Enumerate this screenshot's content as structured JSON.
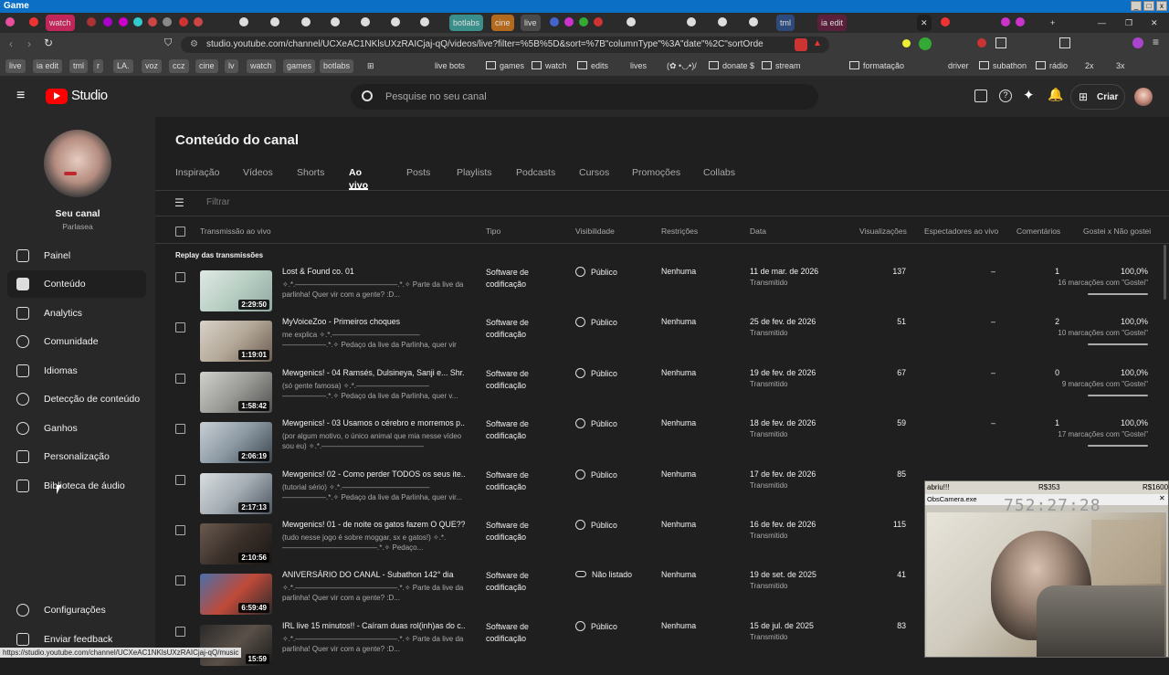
{
  "window": {
    "title": "Game"
  },
  "browser_tabs": [
    "watch",
    "botlabs",
    "cine",
    "live",
    "tml",
    "ia edit"
  ],
  "address_bar": {
    "url": "studio.youtube.com/channel/UCXeAC1NKlsUXzRAICjaj-qQ/videos/live?filter=%5B%5D&sort=%7B\"columnType\"%3A\"date\"%2C\"sortOrder\"%3A\"D..."
  },
  "bookmarks": {
    "chips": [
      "live",
      "ia edit",
      "tml",
      "r",
      "LA.",
      "voz",
      "ccz",
      "cine",
      "lv",
      "watch",
      "games",
      "botlabs"
    ],
    "items": [
      "live bots",
      "games",
      "watch",
      "edits",
      "lives",
      "(✿ •◡•)/",
      "donate $",
      "stream",
      "formatação",
      "driver",
      "subathon",
      "rádio",
      "2x",
      "3x"
    ]
  },
  "header": {
    "logo_text": "Studio",
    "search_placeholder": "Pesquise no seu canal",
    "create_label": "Criar"
  },
  "channel": {
    "name": "Seu canal",
    "handle": "Parlasea"
  },
  "sidebar": {
    "items": [
      {
        "label": "Painel",
        "icon": "dashboard-icon"
      },
      {
        "label": "Conteúdo",
        "icon": "content-icon",
        "active": true
      },
      {
        "label": "Analytics",
        "icon": "analytics-icon"
      },
      {
        "label": "Comunidade",
        "icon": "community-icon"
      },
      {
        "label": "Idiomas",
        "icon": "subtitles-icon"
      },
      {
        "label": "Detecção de conteúdo",
        "icon": "copyright-icon"
      },
      {
        "label": "Ganhos",
        "icon": "earn-icon"
      },
      {
        "label": "Personalização",
        "icon": "customization-icon"
      },
      {
        "label": "Biblioteca de áudio",
        "icon": "audio-library-icon"
      }
    ],
    "settings_label": "Configurações",
    "feedback_label": "Enviar feedback"
  },
  "main": {
    "title": "Conteúdo do canal",
    "tabs": [
      "Inspiração",
      "Vídeos",
      "Shorts",
      "Ao vivo",
      "Posts",
      "Playlists",
      "Podcasts",
      "Cursos",
      "Promoções",
      "Collabs"
    ],
    "active_tab": "Ao vivo",
    "filter_placeholder": "Filtrar",
    "columns": [
      "Transmissão ao vivo",
      "Tipo",
      "Visibilidade",
      "Restrições",
      "Data",
      "Visualizações",
      "Espectadores ao vivo",
      "Comentários",
      "Gostei x Não gostei"
    ],
    "section_label": "Replay das transmissões"
  },
  "rows": [
    {
      "title": "Lost & Found co. 01",
      "desc": "✧.*.——————————————.*.✧ Parte da live da parlinha! Quer vir com a gente? :D...",
      "duration": "2:29:50",
      "type": "Software de codificação",
      "visibility": "Público",
      "restrictions": "Nenhuma",
      "date": "11 de mar. de 2026",
      "status": "Transmitido",
      "views": "137",
      "live_viewers": "–",
      "comments": "1",
      "likes_pct": "100,0%",
      "likes_sub": "16 marcações com \"Gostei\""
    },
    {
      "title": "MyVoiceZoo - Primeiros choques",
      "desc": "me explica ✧.*.———————————— ——————.*.✧ Pedaço da live da Parlinha, quer vir com a...",
      "duration": "1:19:01",
      "type": "Software de codificação",
      "visibility": "Público",
      "restrictions": "Nenhuma",
      "date": "25 de fev. de 2026",
      "status": "Transmitido",
      "views": "51",
      "live_viewers": "–",
      "comments": "2",
      "likes_pct": "100,0%",
      "likes_sub": "10 marcações com \"Gostei\""
    },
    {
      "title": "Mewgenics! - 04 Ramsés, Dulsineya, Sanji e... Shr...",
      "desc": "(só gente famosa) ✧.*.—————————— ——————.*.✧ Pedaço da live da Parlinha, quer v...",
      "duration": "1:58:42",
      "type": "Software de codificação",
      "visibility": "Público",
      "restrictions": "Nenhuma",
      "date": "19 de fev. de 2026",
      "status": "Transmitido",
      "views": "67",
      "live_viewers": "–",
      "comments": "0",
      "likes_pct": "100,0%",
      "likes_sub": "9 marcações com \"Gostei\""
    },
    {
      "title": "Mewgenics! - 03 Usamos o cérebro e morremos p...",
      "desc": "(por algum motivo, o único animal que mia nesse vídeo sou eu) ✧.*.——————————————",
      "duration": "2:06:19",
      "type": "Software de codificação",
      "visibility": "Público",
      "restrictions": "Nenhuma",
      "date": "18 de fev. de 2026",
      "status": "Transmitido",
      "views": "59",
      "live_viewers": "–",
      "comments": "1",
      "likes_pct": "100,0%",
      "likes_sub": "17 marcações com \"Gostei\""
    },
    {
      "title": "Mewgenics! 02 - Como perder TODOS os seus ite...",
      "desc": "(tutorial sério) ✧.*.———————————— ——————.*.✧ Pedaço da live da Parlinha, quer vir...",
      "duration": "2:17:13",
      "type": "Software de codificação",
      "visibility": "Público",
      "restrictions": "Nenhuma",
      "date": "17 de fev. de 2026",
      "status": "Transmitido",
      "views": "85",
      "live_viewers": "",
      "comments": "",
      "likes_pct": "",
      "likes_sub": ""
    },
    {
      "title": "Mewgenics! 01 - de noite os gatos fazem O QUE??!",
      "desc": "(tudo nesse jogo é sobre moggar, sx e gatos!) ✧.*.—————————————.*.✧ Pedaço...",
      "duration": "2:10:56",
      "type": "Software de codificação",
      "visibility": "Público",
      "restrictions": "Nenhuma",
      "date": "16 de fev. de 2026",
      "status": "Transmitido",
      "views": "115",
      "live_viewers": "",
      "comments": "",
      "likes_pct": "",
      "likes_sub": ""
    },
    {
      "title": "ANIVERSÁRIO DO CANAL - Subathon 142° dia",
      "desc": "✧.*.——————————————.*.✧ Parte da live da parlinha! Quer vir com a gente? :D...",
      "duration": "6:59:49",
      "type": "Software de codificação",
      "visibility": "Não listado",
      "restrictions": "Nenhuma",
      "date": "19 de set. de 2025",
      "status": "Transmitido",
      "views": "41",
      "live_viewers": "",
      "comments": "",
      "likes_pct": "",
      "likes_sub": ""
    },
    {
      "title": "IRL live 15 minutos!! - Caíram duas rol(inh)as do c...",
      "desc": "✧.*.——————————————.*.✧ Parte da live da parlinha! Quer vir com a gente? :D...",
      "duration": "15:59",
      "type": "Software de codificação",
      "visibility": "Público",
      "restrictions": "Nenhuma",
      "date": "15 de jul. de 2025",
      "status": "Transmitido",
      "views": "83",
      "live_viewers": "",
      "comments": "",
      "likes_pct": "",
      "likes_sub": ""
    }
  ],
  "webcam_overlay": {
    "top_left": "abriu!!!",
    "top_mid": "R$353",
    "top_right": "R$1600",
    "app": "ObsCamera.exe",
    "timer": "752:27:28"
  },
  "statusbar": {
    "url": "https://studio.youtube.com/channel/UCXeAC1NKlsUXzRAICjaj-qQ/music"
  },
  "colors": {
    "brand_red": "#ff0000",
    "bg": "#1f1f1f",
    "panel": "#282828"
  }
}
